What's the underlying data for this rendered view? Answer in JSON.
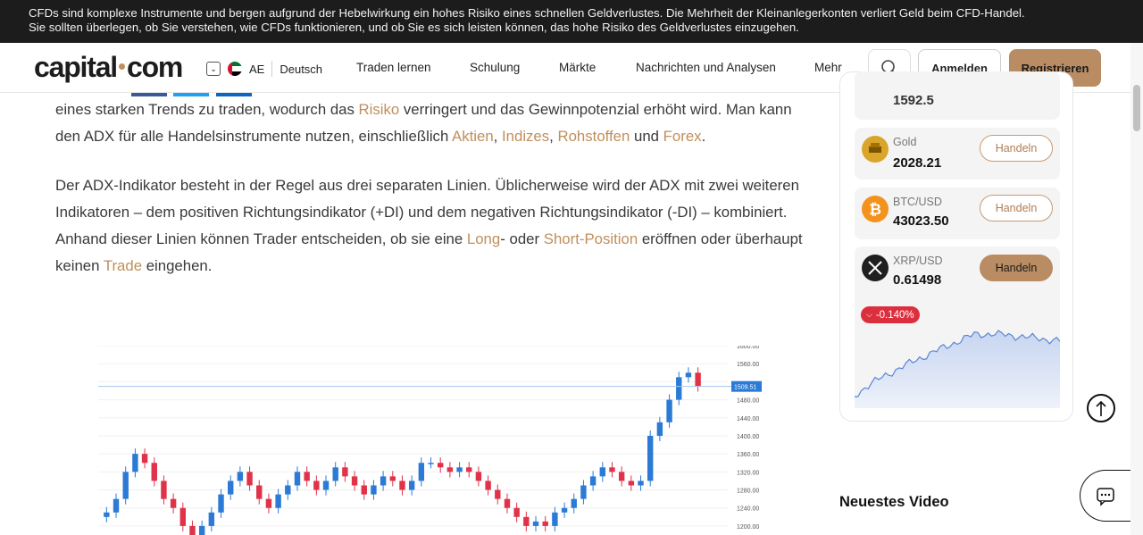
{
  "risk_banner": {
    "line1": "CFDs sind komplexe Instrumente und bergen aufgrund der Hebelwirkung ein hohes Risiko eines schnellen Geldverlustes. Die Mehrheit der Kleinanlegerkonten verliert Geld beim CFD-Handel.",
    "line2": "Sie sollten überlegen, ob Sie verstehen, wie CFDs funktionieren, und ob Sie es sich leisten können, das hohe Risiko des Geldverlustes einzugehen."
  },
  "nav": {
    "logo_left": "capital",
    "logo_right": "com",
    "region": "AE",
    "language": "Deutsch",
    "menu": [
      "Traden lernen",
      "Schulung",
      "Märkte",
      "Nachrichten und Analysen",
      "Mehr"
    ],
    "login": "Anmelden",
    "register": "Registrieren"
  },
  "article": {
    "p1": {
      "a": "eines starken Trends zu traden, wodurch das ",
      "l1": "Risiko",
      "b": " verringert und das Gewinnpotenzial erhöht wird. Man kann den ADX für alle Handelsinstrumente nutzen, einschließlich ",
      "l2": "Aktien",
      "c": ", ",
      "l3": "Indizes",
      "d": ", ",
      "l4": "Rohstoffen",
      "e": " und ",
      "l5": "Forex",
      "f": "."
    },
    "p2": {
      "a": "Der ADX-Indikator besteht in der Regel aus drei separaten Linien. Üblicherweise wird der ADX mit zwei weiteren Indikatoren – dem positiven Richtungsindikator (+DI) und dem negativen Richtungsindikator (-DI) – kombiniert. Anhand dieser Linien können Trader entscheiden, ob sie eine ",
      "l1": "Long",
      "b": "- oder ",
      "l2": "Short-Position",
      "c": " eröffnen oder überhaupt keinen ",
      "l3": "Trade",
      "d": " eingehen."
    }
  },
  "chart_data": {
    "type": "candlestick",
    "y_ticks": [
      "1600.00",
      "1560.00",
      "1509.51",
      "1480.00",
      "1440.00",
      "1400.00",
      "1360.00",
      "1320.00",
      "1280.00",
      "1240.00",
      "1200.00"
    ],
    "last_price_label": "1509.51",
    "ylim": [
      1180,
      1600
    ],
    "closes": [
      1230,
      1260,
      1320,
      1360,
      1340,
      1300,
      1260,
      1240,
      1200,
      1180,
      1200,
      1230,
      1270,
      1300,
      1320,
      1290,
      1260,
      1240,
      1270,
      1290,
      1320,
      1300,
      1280,
      1300,
      1330,
      1310,
      1290,
      1270,
      1290,
      1310,
      1300,
      1280,
      1300,
      1340,
      1340,
      1330,
      1320,
      1330,
      1320,
      1300,
      1280,
      1260,
      1240,
      1220,
      1200,
      1210,
      1200,
      1230,
      1240,
      1260,
      1290,
      1310,
      1330,
      1320,
      1300,
      1290,
      1300,
      1400,
      1430,
      1480,
      1530,
      1540,
      1510
    ]
  },
  "sidebar": {
    "partial_price": "1592.5",
    "instruments": [
      {
        "name": "Gold",
        "price": "2028.21",
        "button": "Handeln",
        "icon": "gold-icon"
      },
      {
        "name": "BTC/USD",
        "price": "43023.50",
        "button": "Handeln",
        "icon": "bitcoin-icon"
      },
      {
        "name": "XRP/USD",
        "price": "0.61498",
        "button": "Handeln",
        "icon": "xrp-icon"
      }
    ],
    "change": "-0.140%",
    "colors": {
      "accent": "#c08f5c",
      "negative": "#dc2f3e",
      "spark_line": "#5a86d6"
    }
  },
  "newest_video": "Neuestes Video"
}
